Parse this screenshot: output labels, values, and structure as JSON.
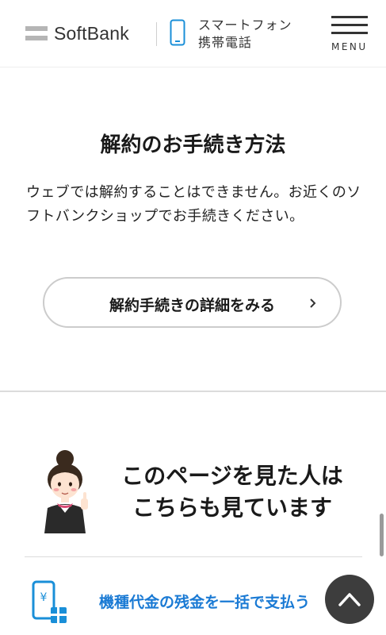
{
  "header": {
    "logo_text": "SoftBank",
    "category_line1": "スマートフォン",
    "category_line2": "携帯電話",
    "menu_label": "MENU"
  },
  "cancellation": {
    "title": "解約のお手続き方法",
    "description": "ウェブでは解約することはできません。お近くのソフトバンクショップでお手続きください。",
    "button_label": "解約手続きの詳細をみる"
  },
  "related": {
    "heading_line1": "このページを見た人は",
    "heading_line2": "こちらも見ています",
    "link_label": "機種代金の残金を一括で支払う"
  },
  "colors": {
    "link": "#1a7ad4",
    "logo_gray": "#b5b5b5",
    "phone_icon": "#1a8fd8",
    "back_to_top": "#3d3d3d"
  },
  "icons": [
    "phone-icon",
    "hamburger-menu-icon",
    "chevron-right-icon",
    "mascot-illustration",
    "smartphone-yen-payment-icon",
    "chevron-up-icon"
  ]
}
